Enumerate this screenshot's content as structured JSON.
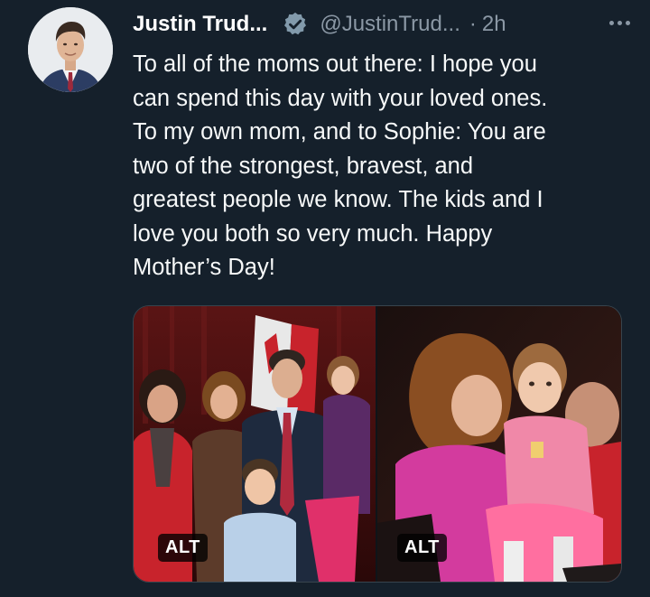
{
  "author": {
    "name": "Justin Trud...",
    "handle": "@JustinTrud...",
    "separator": "·",
    "time": "2h",
    "verified": true
  },
  "tweet": {
    "text": "To all of the moms out there: I hope you\ncan spend this day with your loved ones.\nTo my own mom, and to Sophie: You are\ntwo of the strongest, bravest, and\ngreatest people we know. The kids and I\nlove you both so very much. Happy\nMother’s Day!"
  },
  "media": [
    {
      "alt_label": "ALT"
    },
    {
      "alt_label": "ALT"
    }
  ],
  "icons": {
    "verified": "verified-badge-icon",
    "more": "more-options-icon"
  },
  "colors": {
    "background": "#15202b",
    "secondary_text": "#8b98a5",
    "primary_text": "#f7f9f9"
  }
}
